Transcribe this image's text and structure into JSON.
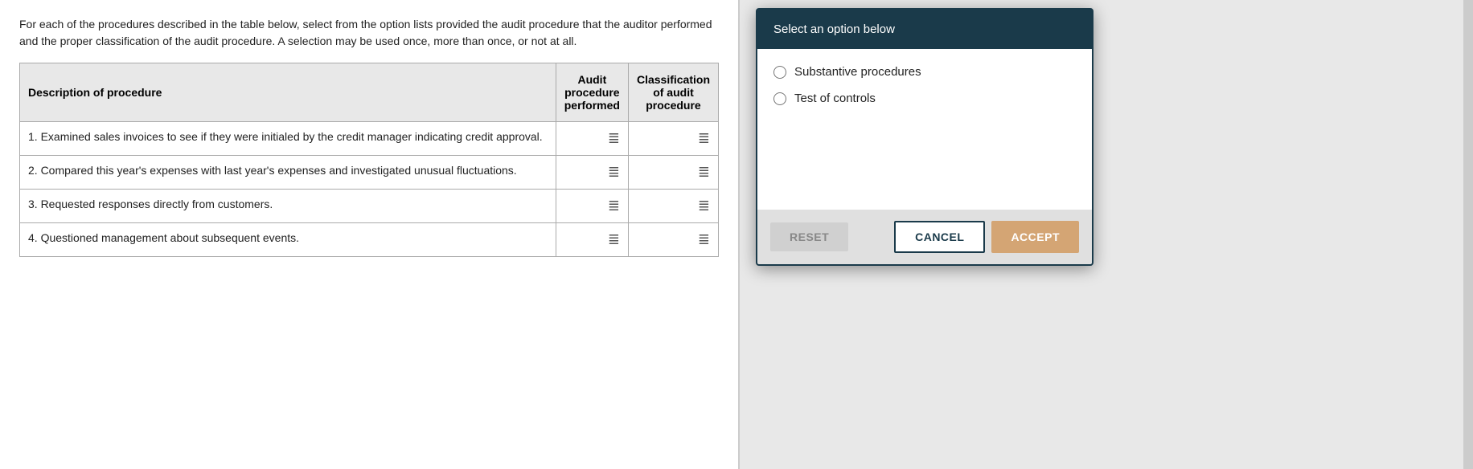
{
  "intro": {
    "text": "For each of the procedures described in the table below, select from the option lists provided the audit procedure that the auditor performed and the proper classification of the audit procedure. A selection may be used once, more than once, or not at all."
  },
  "table": {
    "headers": {
      "description": "Description of procedure",
      "procedure": "Audit procedure performed",
      "classification": "Classification of audit procedure"
    },
    "rows": [
      {
        "description": "1. Examined sales invoices to see if they were initialed by the credit manager indicating credit approval.",
        "procedure_icon": "☰",
        "classification_icon": "☰"
      },
      {
        "description": "2. Compared this year's expenses with last year's expenses and investigated unusual fluctuations.",
        "procedure_icon": "☰",
        "classification_icon": "☰"
      },
      {
        "description": "3. Requested responses directly from customers.",
        "procedure_icon": "☰",
        "classification_icon": "☰"
      },
      {
        "description": "4. Questioned management about subsequent events.",
        "procedure_icon": "☰",
        "classification_icon": "☰"
      }
    ]
  },
  "modal": {
    "header": "Select an option below",
    "options": [
      {
        "label": "Substantive procedures",
        "value": "substantive"
      },
      {
        "label": "Test of controls",
        "value": "test_of_controls"
      }
    ],
    "buttons": {
      "reset": "RESET",
      "cancel": "CANCEL",
      "accept": "ACCEPT"
    }
  }
}
